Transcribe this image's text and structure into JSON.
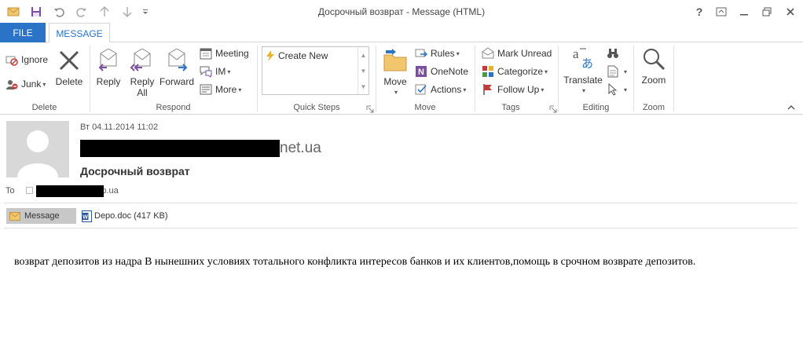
{
  "window": {
    "title": "Досрочный возврат - Message (HTML)"
  },
  "tabs": {
    "file": "FILE",
    "message": "MESSAGE"
  },
  "ribbon": {
    "groups": {
      "delete": "Delete",
      "respond": "Respond",
      "quick_steps": "Quick Steps",
      "move": "Move",
      "tags": "Tags",
      "editing": "Editing",
      "zoom": "Zoom"
    },
    "ignore": "Ignore",
    "junk": "Junk",
    "delete_btn": "Delete",
    "reply": "Reply",
    "reply_all_1": "Reply",
    "reply_all_2": "All",
    "forward": "Forward",
    "meeting": "Meeting",
    "im": "IM",
    "more": "More",
    "create_new": "Create New",
    "move_btn": "Move",
    "rules": "Rules",
    "onenote": "OneNote",
    "actions": "Actions",
    "mark_unread": "Mark Unread",
    "categorize": "Categorize",
    "follow_up": "Follow Up",
    "translate": "Translate",
    "zoom_btn": "Zoom"
  },
  "message": {
    "date": "Вт 04.11.2014 11:02",
    "from_suffix": "net.ua",
    "subject": "Досрочный возврат",
    "to_label": "To",
    "to_suffix": "n.dp.ua",
    "attach_message": "Message",
    "attach_file": "Depo.doc (417 KB)",
    "body": "возврат депозитов из надра В нынешних условиях тотального конфликта интересов банков и их клиентов,помощь в срочном возврате депозитов."
  },
  "colors": {
    "accent": "#2b73c6",
    "redaction": "#000000"
  }
}
